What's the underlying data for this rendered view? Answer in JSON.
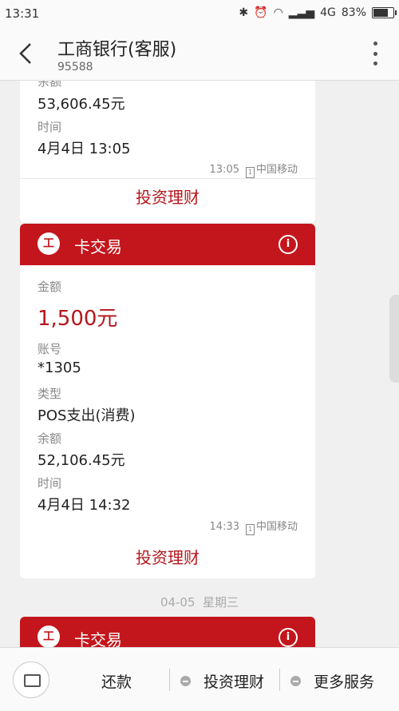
{
  "status": {
    "time": "13:31",
    "network": "4G",
    "battery": "83%",
    "battery_level": 0.83
  },
  "header": {
    "title": "工商银行(客服)",
    "subtitle": "95588"
  },
  "messages": [
    {
      "partial_label": "余额",
      "balance_value": "53,606.45元",
      "time_label": "时间",
      "time_value": "4月4日 13:05",
      "meta_time": "13:05",
      "sim_icon": "1",
      "carrier": "中国移动",
      "action": "投资理财"
    },
    {
      "card_title": "卡交易",
      "logo_text": "工",
      "amount_label": "金额",
      "amount_value": "1,500元",
      "account_label": "账号",
      "account_value": "*1305",
      "type_label": "类型",
      "type_value": "POS支出(消费)",
      "balance_label": "余额",
      "balance_value": "52,106.45元",
      "time_label": "时间",
      "time_value": "4月4日 14:32",
      "meta_time": "14:33",
      "sim_icon": "1",
      "carrier": "中国移动",
      "action": "投资理财"
    }
  ],
  "date_separator": "04-05  星期三",
  "next_card": {
    "card_title": "卡交易",
    "logo_text": "工"
  },
  "bottom_bar": {
    "tabs": [
      "还款",
      "投资理财",
      "更多服务"
    ]
  },
  "colors": {
    "brand_red": "#c3161c",
    "amount_red": "#b5161c"
  }
}
